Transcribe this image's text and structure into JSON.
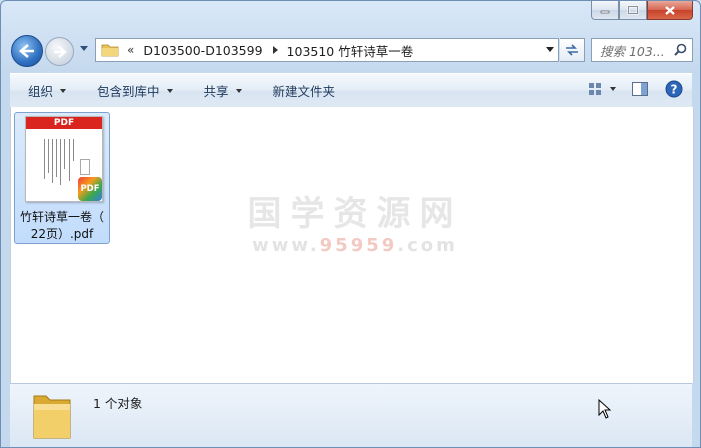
{
  "window": {
    "title_buttons": {
      "minimize": "minimize-icon",
      "maximize": "maximize-icon",
      "close": "close-icon"
    }
  },
  "nav": {
    "back": "back-arrow-icon",
    "forward": "forward-arrow-icon",
    "recent": "chevron-down-icon"
  },
  "address": {
    "overflow": "«",
    "segments": [
      "D103500-D103599",
      "103510 竹轩诗草一卷"
    ]
  },
  "search": {
    "placeholder": "搜索 103..."
  },
  "toolbar": {
    "organize": "组织",
    "include_in_library": "包含到库中",
    "share": "共享",
    "new_folder": "新建文件夹"
  },
  "files": [
    {
      "name_line1": "竹轩诗草一卷（",
      "name_line2": "22页）.pdf",
      "thumb_header": "PDF",
      "badge": "PDF"
    }
  ],
  "watermark": {
    "title": "国学资源网",
    "url_prefix": "www.",
    "url_highlight": "95959",
    "url_suffix": ".com"
  },
  "details": {
    "count_text": "1 个对象"
  },
  "colors": {
    "accent": "#1e395b",
    "selection": "#c1dcfc",
    "pdf_red": "#d9251e"
  }
}
